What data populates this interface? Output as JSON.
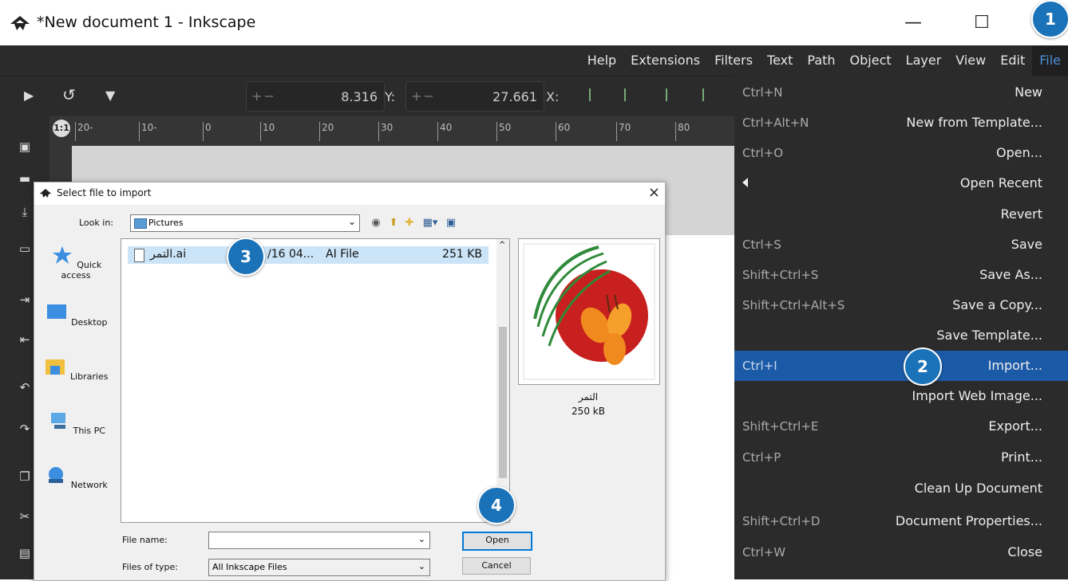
{
  "window": {
    "title": "*New document 1 - Inkscape",
    "controls": {
      "minimize": "—",
      "maximize": "☐"
    }
  },
  "menubar": [
    "File",
    "Edit",
    "View",
    "Layer",
    "Object",
    "Path",
    "Text",
    "Filters",
    "Extensions",
    "Help"
  ],
  "toolbar": {
    "x_label": "X:",
    "x_value": "27.661",
    "y_label": "Y:",
    "y_value": "8.316",
    "plus_minus": "+−"
  },
  "ruler": {
    "corner": "1:1",
    "ticks": [
      "20-",
      "10-",
      "0",
      "10",
      "20",
      "30",
      "40",
      "50",
      "60",
      "70",
      "80"
    ]
  },
  "file_menu": [
    {
      "shortcut": "Ctrl+N",
      "label": "New"
    },
    {
      "shortcut": "Ctrl+Alt+N",
      "label": "New from Template..."
    },
    {
      "shortcut": "Ctrl+O",
      "label": "Open..."
    },
    {
      "shortcut": "",
      "label": "Open Recent",
      "submenu": true
    },
    {
      "shortcut": "",
      "label": "Revert"
    },
    {
      "shortcut": "Ctrl+S",
      "label": "Save"
    },
    {
      "shortcut": "Shift+Ctrl+S",
      "label": "Save As..."
    },
    {
      "shortcut": "Shift+Ctrl+Alt+S",
      "label": "Save a Copy..."
    },
    {
      "shortcut": "",
      "label": "Save Template..."
    },
    {
      "shortcut": "Ctrl+I",
      "label": "Import...",
      "highlighted": true
    },
    {
      "shortcut": "",
      "label": "Import Web Image..."
    },
    {
      "shortcut": "Shift+Ctrl+E",
      "label": "Export..."
    },
    {
      "shortcut": "Ctrl+P",
      "label": "Print..."
    },
    {
      "shortcut": "",
      "label": "Clean Up Document"
    },
    {
      "shortcut": "Shift+Ctrl+D",
      "label": "Document Properties..."
    },
    {
      "shortcut": "Ctrl+W",
      "label": "Close"
    }
  ],
  "dialog": {
    "title": "Select file to import",
    "close": "×",
    "look_in_label": "Look in:",
    "look_in_value": "Pictures",
    "places": [
      "Quick access",
      "Desktop",
      "Libraries",
      "This PC",
      "Network"
    ],
    "file": {
      "name": "التمر.ai",
      "date": "/16 04...",
      "type": "AI File",
      "size": "251 KB"
    },
    "preview_name": "التمر",
    "preview_size": "250 kB",
    "file_name_label": "File name:",
    "file_name_value": "",
    "files_of_type_label": "Files of type:",
    "files_of_type_value": "All Inkscape Files",
    "open_button": "Open",
    "cancel_button": "Cancel"
  },
  "badges": [
    "1",
    "2",
    "3",
    "4"
  ],
  "colors": {
    "menu_bg": "#2b2b2b",
    "highlight": "#1b5aa6",
    "badge": "#1a72b8",
    "active_menu": "#4d8fd6"
  }
}
